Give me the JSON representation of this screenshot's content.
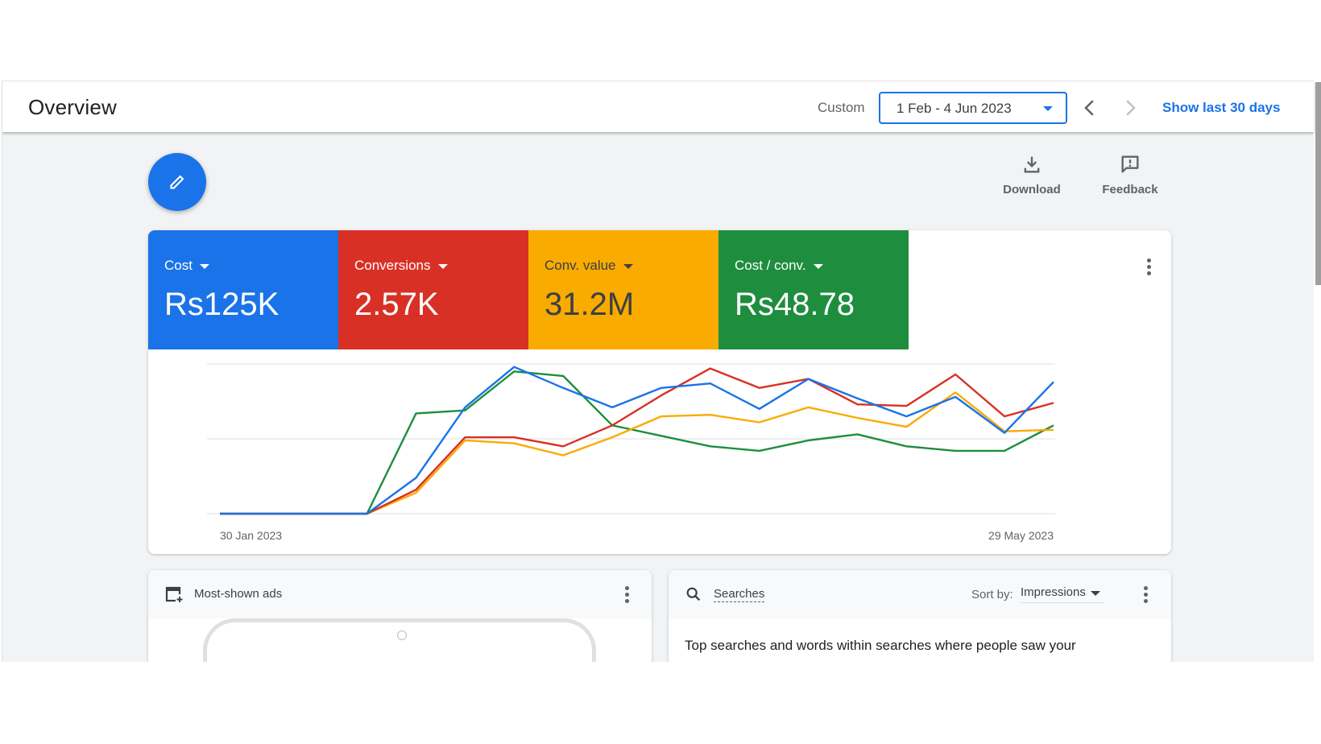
{
  "header": {
    "title": "Overview",
    "custom_label": "Custom",
    "date_range": "1 Feb - 4 Jun 2023",
    "prev_icon": "chevron-left-icon",
    "next_icon": "chevron-right-icon",
    "show_last_label": "Show last 30 days"
  },
  "toolbar": {
    "edit_icon": "pencil-icon",
    "download_label": "Download",
    "feedback_label": "Feedback"
  },
  "metrics": [
    {
      "name": "Cost",
      "value": "Rs125K",
      "color": "#1a73e8"
    },
    {
      "name": "Conversions",
      "value": "2.57K",
      "color": "#d93025"
    },
    {
      "name": "Conv. value",
      "value": "31.2M",
      "color": "#f9ab00"
    },
    {
      "name": "Cost / conv.",
      "value": "Rs48.78",
      "color": "#1e8e3e"
    }
  ],
  "chart_data": {
    "type": "line",
    "title": "",
    "xlabel": "",
    "ylabel": "",
    "x_tick_labels": [
      "30 Jan 2023",
      "29 May 2023"
    ],
    "x_points": 18,
    "y_range_normalized": [
      0,
      100
    ],
    "grid": true,
    "legend": "none (metric tiles act as legend)",
    "series": [
      {
        "name": "Cost",
        "color": "#1a73e8",
        "values": [
          0,
          0,
          0,
          0,
          24,
          71,
          98,
          84,
          71,
          84,
          87,
          70,
          90,
          77,
          65,
          78,
          54,
          88
        ]
      },
      {
        "name": "Conversions",
        "color": "#d93025",
        "values": [
          0,
          0,
          0,
          0,
          16,
          51,
          51,
          45,
          59,
          79,
          97,
          84,
          90,
          73,
          72,
          93,
          65,
          74
        ]
      },
      {
        "name": "Conv. value",
        "color": "#f9ab00",
        "values": [
          0,
          0,
          0,
          0,
          14,
          49,
          47,
          39,
          51,
          65,
          66,
          61,
          71,
          64,
          58,
          81,
          55,
          56
        ]
      },
      {
        "name": "Cost / conv.",
        "color": "#1e8e3e",
        "values": [
          0,
          0,
          0,
          0,
          67,
          69,
          95,
          92,
          59,
          52,
          45,
          42,
          49,
          53,
          45,
          42,
          42,
          59
        ]
      }
    ]
  },
  "most_shown_ads": {
    "title": "Most-shown ads",
    "icon": "ad-add-icon"
  },
  "searches": {
    "title": "Searches",
    "icon": "search-icon",
    "sort_label": "Sort by:",
    "sort_value": "Impressions",
    "description": "Top searches and words within searches where people saw your"
  }
}
